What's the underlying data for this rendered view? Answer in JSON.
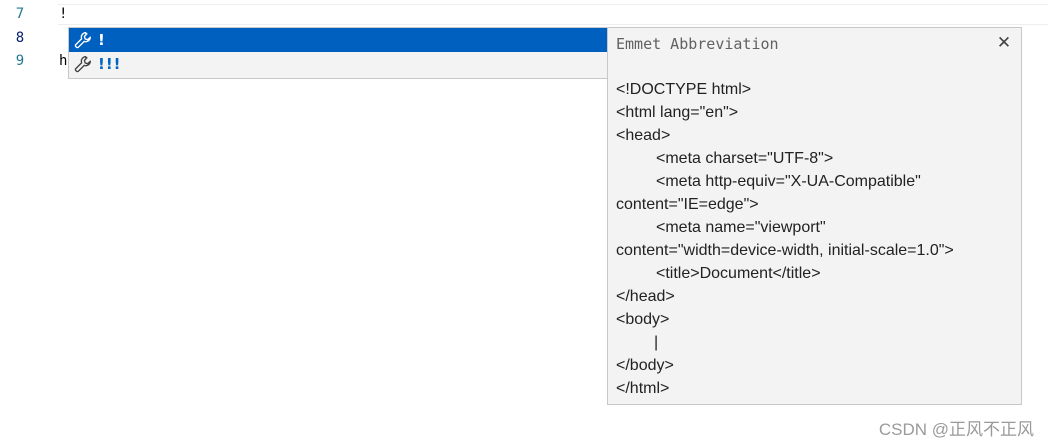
{
  "editor": {
    "lines": [
      {
        "number": "7",
        "text": "!"
      },
      {
        "number": "8",
        "text": ""
      },
      {
        "number": "9",
        "text": "h"
      }
    ]
  },
  "suggest": {
    "items": [
      {
        "label": "!",
        "icon": "wrench-icon",
        "selected": true
      },
      {
        "label": "!!!",
        "icon": "wrench-icon",
        "selected": false
      }
    ]
  },
  "details": {
    "title": "Emmet Abbreviation",
    "close_label": "✕",
    "lines": [
      "<!DOCTYPE html>",
      "<html lang=\"en\">",
      "<head>",
      "<meta charset=\"UTF-8\">",
      "<meta http-equiv=\"X-UA-Compatible\"",
      "content=\"IE=edge\">",
      "<meta name=\"viewport\"",
      "content=\"width=device-width, initial-scale=1.0\">",
      "<title>Document</title>",
      "</head>",
      "<body>",
      "|",
      "</body>",
      "</html>"
    ]
  },
  "watermark": "CSDN @正风不正风",
  "colors": {
    "selection": "#0060c0",
    "line_number": "#237893",
    "label": "#0066bf"
  }
}
